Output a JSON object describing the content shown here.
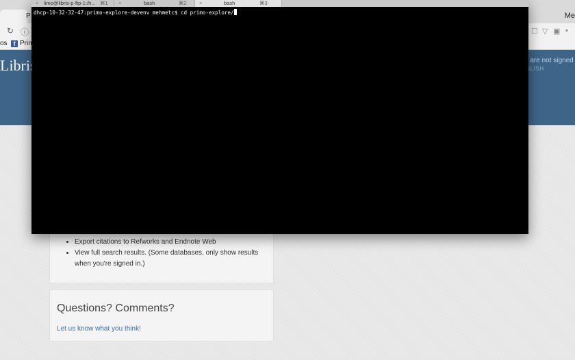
{
  "browser": {
    "tab_label": "P",
    "right_label": "Me",
    "bookmarks": [
      "os",
      "Prim"
    ],
    "header": {
      "logo": "Libris",
      "signin_text": "u are not signed",
      "language": "GLISH"
    },
    "card1": {
      "items": [
        "Export citations to Refworks and Endnote Web",
        "View full search results. (Some databases, only show results when you're signed in.)"
      ]
    },
    "card2": {
      "heading": "Questions? Comments?",
      "link": "Let us know what you think!"
    }
  },
  "terminal": {
    "tabs": [
      {
        "title": "limo@libris-p-ftp-1:/h...",
        "shortcut": "⌘1"
      },
      {
        "title": "bash",
        "shortcut": "⌘2"
      },
      {
        "title": "bash",
        "shortcut": "⌘3",
        "active": true
      }
    ],
    "close_glyph": "×",
    "prompt": "dhcp-10-32-32-47:primo-explore-devenv mehmetc$ ",
    "command": "cd primo-explore/"
  }
}
